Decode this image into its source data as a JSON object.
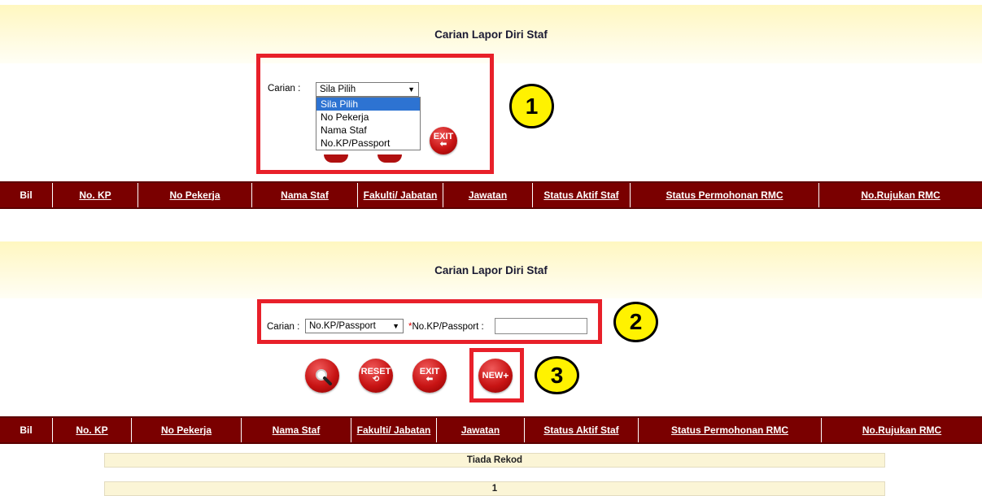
{
  "top": {
    "title": "Carian Lapor Diri Staf",
    "carian_label": "Carian :",
    "select_value": "Sila Pilih",
    "dropdown_options": [
      "Sila Pilih",
      "No Pekerja",
      "Nama Staf",
      "No.KP/Passport"
    ],
    "exit_label": "EXIT",
    "badge": "1"
  },
  "table_headers": [
    "Bil",
    "No. KP",
    "No Pekerja",
    "Nama Staf",
    "Fakulti/ Jabatan",
    "Jawatan",
    "Status Aktif Staf",
    "Status Permohonan RMC",
    "No.Rujukan RMC"
  ],
  "bottom": {
    "title": "Carian Lapor Diri Staf",
    "carian_label": "Carian :",
    "select_value": "No.KP/Passport",
    "required_mark": "*",
    "field_label": "No.KP/Passport :",
    "field_value": "",
    "badge_2": "2",
    "badge_3": "3",
    "buttons": {
      "reset": "RESET",
      "exit": "EXIT",
      "new": "NEW"
    },
    "empty_message": "Tiada Rekod",
    "page_number": "1"
  },
  "colors": {
    "header_bg": "#7a0000",
    "highlight_box": "#e8202a",
    "badge": "#fff200",
    "button_red": "#c81414"
  }
}
